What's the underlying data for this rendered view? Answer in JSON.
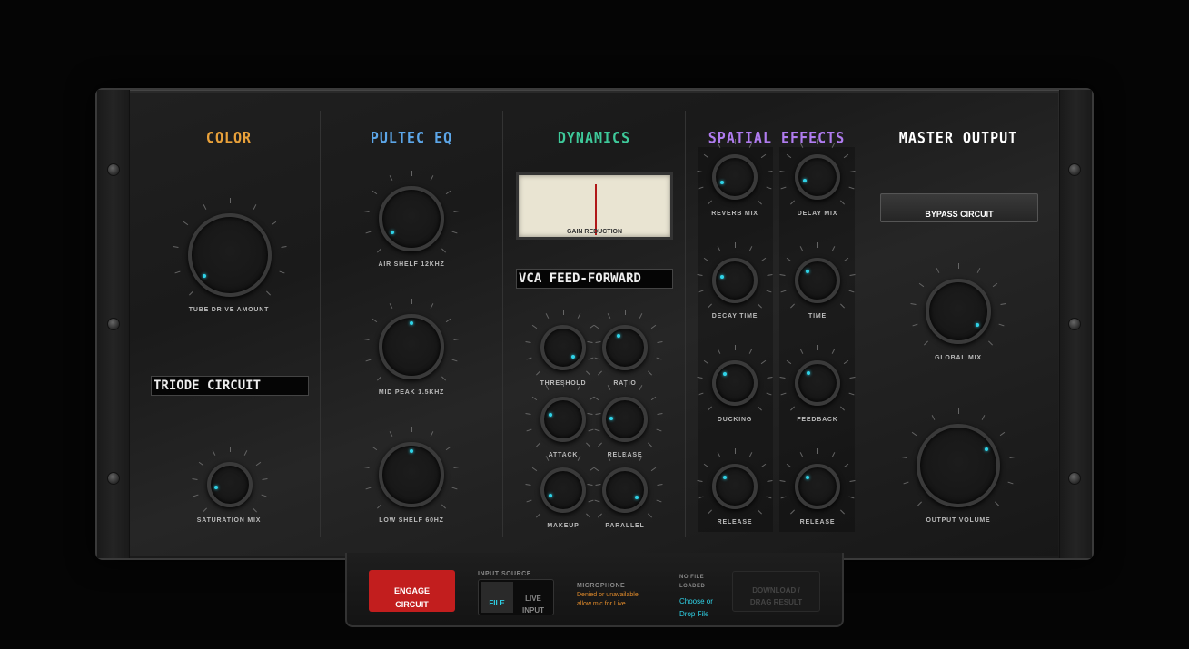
{
  "sections": {
    "color": {
      "title": "COLOR",
      "accent": "#e9a13a",
      "tube_drive_label": "TUBE DRIVE AMOUNT",
      "circuit_select": "TRIODE CIRCUIT",
      "saturation_label": "SATURATION MIX"
    },
    "pultec": {
      "title": "PULTEC EQ",
      "accent": "#5ca6e8",
      "air_label": "AIR SHELF 12KHZ",
      "mid_label": "MID PEAK 1.5KHZ",
      "low_label": "LOW SHELF 60HZ"
    },
    "dynamics": {
      "title": "DYNAMICS",
      "accent": "#3ec99a",
      "meter_label": "GAIN REDUCTION",
      "mode_select": "VCA FEED-FORWARD",
      "knobs": [
        "THRESHOLD",
        "RATIO",
        "ATTACK",
        "RELEASE",
        "MAKEUP",
        "PARALLEL"
      ]
    },
    "spatial": {
      "title": "SPATIAL EFFECTS",
      "accent": "#b07cf0",
      "reverb": [
        "REVERB MIX",
        "DECAY TIME",
        "DUCKING",
        "RELEASE"
      ],
      "delay": [
        "DELAY MIX",
        "TIME",
        "FEEDBACK",
        "RELEASE"
      ]
    },
    "master": {
      "title": "MASTER OUTPUT",
      "accent": "#ffffff",
      "bypass_label": "BYPASS CIRCUIT",
      "global_mix_label": "GLOBAL MIX",
      "output_label": "OUTPUT VOLUME"
    }
  },
  "tray": {
    "engage_line1": "ENGAGE",
    "engage_line2": "CIRCUIT",
    "input_source_label": "INPUT SOURCE",
    "file_option": "FILE",
    "live_line1": "LIVE",
    "live_line2": "INPUT",
    "microphone_label": "MICROPHONE",
    "mic_status": "Denied or unavailable — allow mic for Live",
    "no_file_line1": "NO FILE",
    "no_file_line2": "LOADED",
    "choose_line1": "Choose or",
    "choose_line2": "Drop File",
    "download_line1": "DOWNLOAD /",
    "download_line2": "DRAG RESULT"
  },
  "colors": {
    "knob_indicator": "#2fd3e8",
    "engage": "#c21e1e",
    "mic_status": "#e08a2a"
  }
}
